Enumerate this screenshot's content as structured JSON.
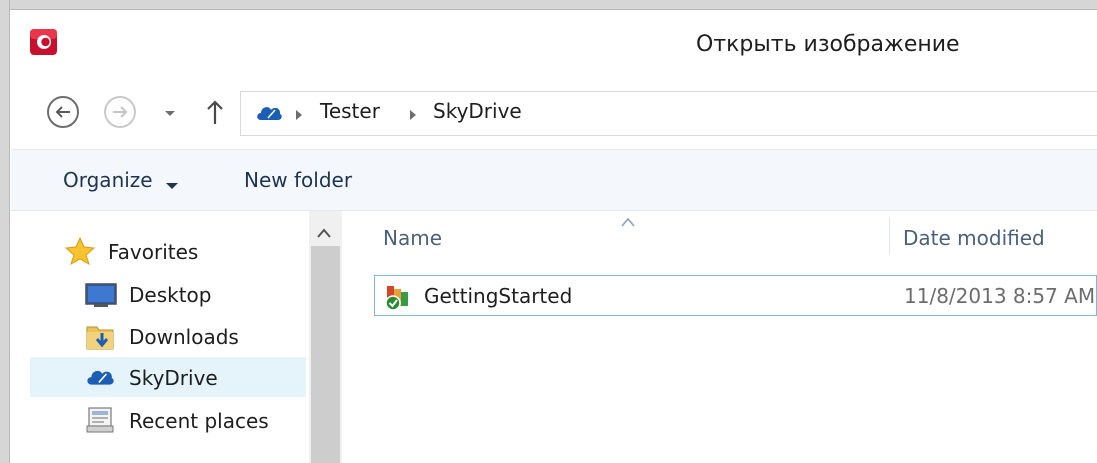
{
  "window": {
    "title": "Открыть изображение",
    "app_icon": "app-logo-icon",
    "accent": "#c8102e"
  },
  "navigation": {
    "back_icon": "back-arrow-icon",
    "forward_icon": "forward-arrow-icon",
    "recent_dropdown_icon": "chevron-down-icon",
    "up_icon": "up-arrow-icon"
  },
  "address_bar": {
    "root_icon": "skydrive-cloud-icon",
    "breadcrumbs": [
      "Tester",
      "SkyDrive"
    ]
  },
  "toolbar": {
    "organize_label": "Organize",
    "new_folder_label": "New folder"
  },
  "nav_pane": {
    "items": [
      {
        "label": "Favorites",
        "icon": "star-icon"
      },
      {
        "label": "Desktop",
        "icon": "desktop-icon"
      },
      {
        "label": "Downloads",
        "icon": "downloads-folder-icon"
      },
      {
        "label": "SkyDrive",
        "icon": "skydrive-cloud-icon",
        "selected": true
      },
      {
        "label": "Recent places",
        "icon": "recent-places-icon"
      }
    ]
  },
  "file_list": {
    "columns": [
      "Name",
      "Date modified"
    ],
    "sorted_column": "Name",
    "rows": [
      {
        "name": "GettingStarted",
        "date_modified": "11/8/2013 8:57 AM",
        "icon": "office-document-sync-icon"
      }
    ]
  }
}
